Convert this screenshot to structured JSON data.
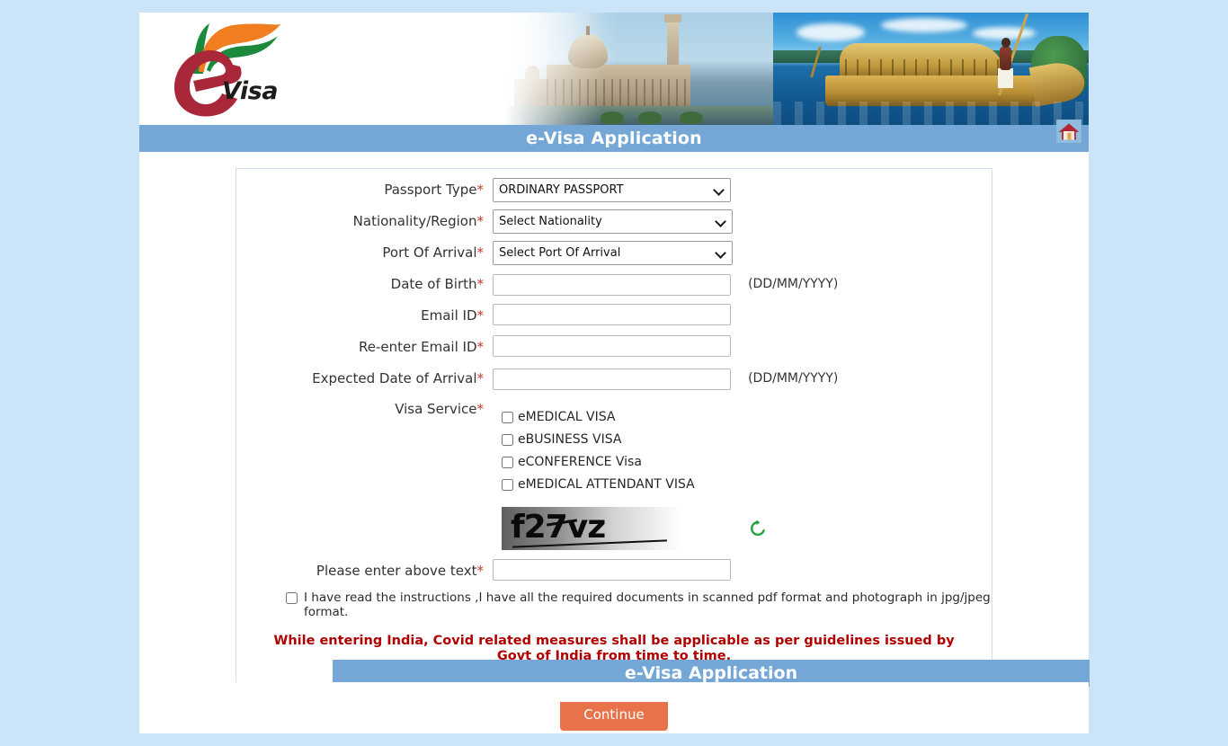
{
  "page": {
    "background_color": "#cce4f8",
    "panel_color": "#ffffff"
  },
  "brand": {
    "logo_e_letter": "e",
    "logo_word": "Visa",
    "logo_icon": "evisa-logo-icon",
    "banner_icon": "india-banner-photo"
  },
  "header": {
    "title": "e-Visa Application",
    "bar_color": "#74a7d6",
    "home_icon": "home-icon"
  },
  "footer": {
    "title": "e-Visa Application"
  },
  "form": {
    "passport_type": {
      "label": "Passport Type",
      "required_mark": "*",
      "value": "ORDINARY PASSPORT",
      "options": [
        "ORDINARY PASSPORT"
      ]
    },
    "nationality": {
      "label": "Nationality/Region",
      "required_mark": "*",
      "value": "Select Nationality",
      "options": [
        "Select Nationality"
      ]
    },
    "port_of_arrival": {
      "label": "Port Of Arrival",
      "required_mark": "*",
      "value": "Select Port Of Arrival",
      "options": [
        "Select Port Of Arrival"
      ]
    },
    "date_of_birth": {
      "label": "Date of Birth",
      "required_mark": "*",
      "value": "",
      "placeholder": "",
      "hint": "(DD/MM/YYYY)"
    },
    "email_id": {
      "label": "Email ID",
      "required_mark": "*",
      "value": "",
      "placeholder": ""
    },
    "reenter_email_id": {
      "label": "Re-enter Email ID",
      "required_mark": "*",
      "value": "",
      "placeholder": ""
    },
    "expected_date_of_arrival": {
      "label": "Expected Date of Arrival",
      "required_mark": "*",
      "value": "",
      "placeholder": "",
      "hint": "(DD/MM/YYYY)"
    },
    "visa_service": {
      "label": "Visa Service",
      "required_mark": "*",
      "options": [
        {
          "label": "eMEDICAL VISA",
          "checked": false
        },
        {
          "label": "eBUSINESS VISA",
          "checked": false
        },
        {
          "label": "eCONFERENCE Visa",
          "checked": false
        },
        {
          "label": "eMEDICAL ATTENDANT VISA",
          "checked": false
        }
      ]
    },
    "captcha": {
      "text": "f27vz",
      "refresh_icon": "refresh-icon",
      "refresh_color": "#22a13c"
    },
    "captcha_answer": {
      "label": "Please enter above text",
      "required_mark": "*",
      "value": "",
      "placeholder": ""
    },
    "declaration": {
      "text": "I have read the instructions ,I have all the required documents in scanned pdf format and photograph in jpg/jpeg format.",
      "checked": false
    },
    "covid_notice": {
      "text": "While entering India, Covid related measures shall be applicable as per guidelines issued by Govt of India from time to time.",
      "color": "#b00000"
    },
    "continue_button": {
      "label": "Continue",
      "color": "#e8734a"
    }
  }
}
